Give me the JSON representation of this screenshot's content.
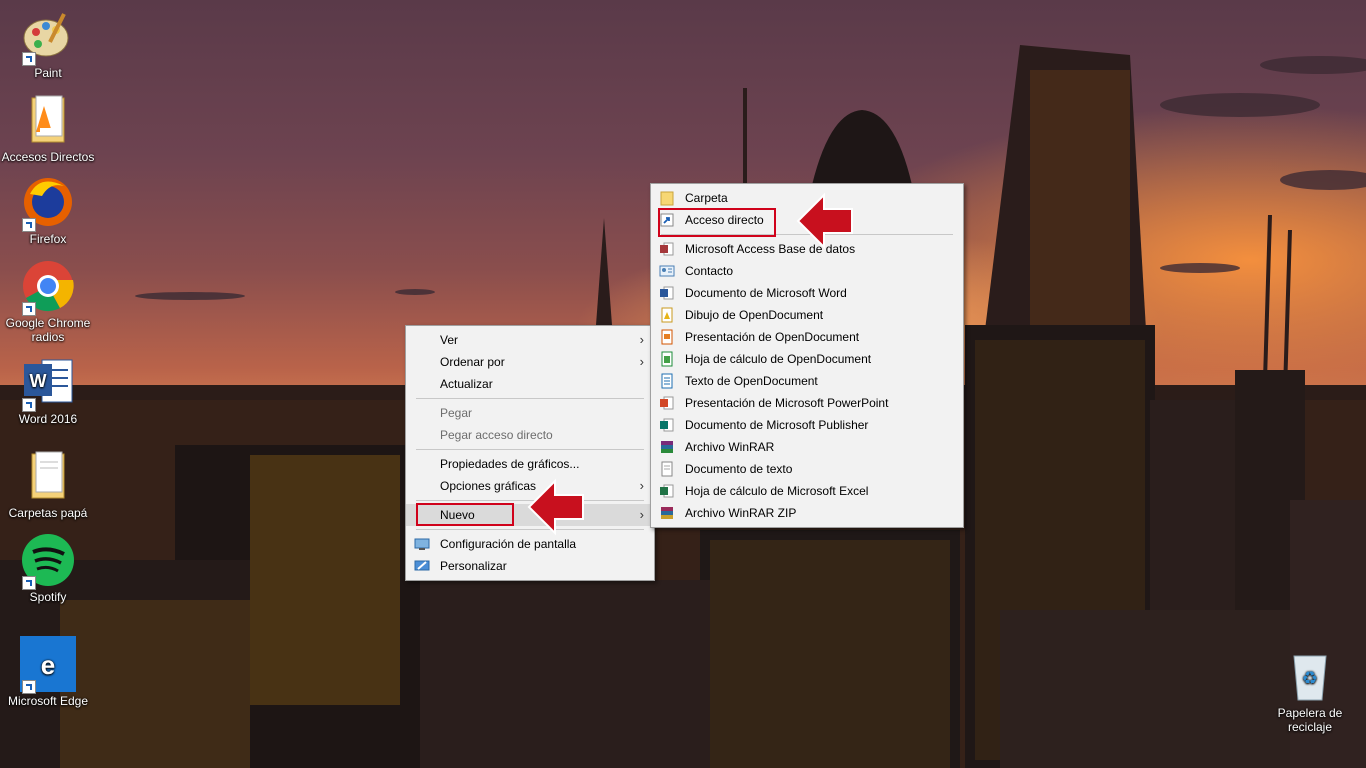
{
  "desktop": {
    "icons": [
      {
        "label": "Paint"
      },
      {
        "label": "Accesos Directos"
      },
      {
        "label": "Firefox"
      },
      {
        "label": "Google Chrome\nradios"
      },
      {
        "label": "Word 2016"
      },
      {
        "label": "Carpetas papá"
      },
      {
        "label": "Spotify"
      },
      {
        "label": "Microsoft Edge"
      },
      {
        "label": "Papelera de\nreciclaje"
      }
    ]
  },
  "context_menu": {
    "items": [
      {
        "label": "Ver"
      },
      {
        "label": "Ordenar por"
      },
      {
        "label": "Actualizar"
      },
      {
        "label": "Pegar"
      },
      {
        "label": "Pegar acceso directo"
      },
      {
        "label": "Propiedades de gráficos..."
      },
      {
        "label": "Opciones gráficas"
      },
      {
        "label": "Nuevo"
      },
      {
        "label": "Configuración de pantalla"
      },
      {
        "label": "Personalizar"
      }
    ]
  },
  "submenu_nuevo": {
    "items": [
      {
        "label": "Carpeta",
        "icon": "folder-icon"
      },
      {
        "label": "Acceso directo",
        "icon": "shortcut-icon"
      },
      {
        "label": "Microsoft Access Base de datos",
        "icon": "access-icon"
      },
      {
        "label": "Contacto",
        "icon": "contact-icon"
      },
      {
        "label": "Documento de Microsoft Word",
        "icon": "word-icon"
      },
      {
        "label": "Dibujo de OpenDocument",
        "icon": "odg-icon"
      },
      {
        "label": "Presentación de OpenDocument",
        "icon": "odp-icon"
      },
      {
        "label": "Hoja de cálculo de OpenDocument",
        "icon": "ods-icon"
      },
      {
        "label": "Texto de OpenDocument",
        "icon": "odt-icon"
      },
      {
        "label": "Presentación de Microsoft PowerPoint",
        "icon": "powerpoint-icon"
      },
      {
        "label": "Documento de Microsoft Publisher",
        "icon": "publisher-icon"
      },
      {
        "label": "Archivo WinRAR",
        "icon": "winrar-icon"
      },
      {
        "label": "Documento de texto",
        "icon": "text-document-icon"
      },
      {
        "label": "Hoja de cálculo de Microsoft Excel",
        "icon": "excel-icon"
      },
      {
        "label": "Archivo WinRAR ZIP",
        "icon": "winrar-zip-icon"
      }
    ]
  },
  "colors": {
    "highlight_box": "#d0021b",
    "menu_bg": "#f2f2f2"
  }
}
